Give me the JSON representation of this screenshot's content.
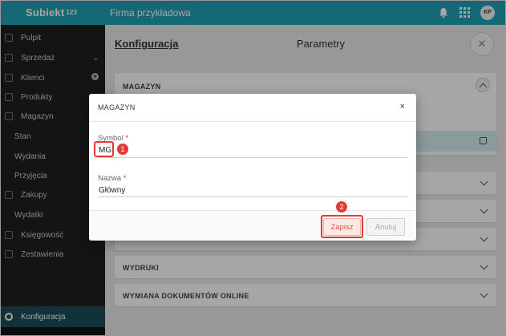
{
  "app": {
    "logo": "Subiekt",
    "logo_sup": "123",
    "company": "Firma przykładowa",
    "avatar": "KP"
  },
  "sidebar": {
    "items": [
      {
        "label": "Pulpit"
      },
      {
        "label": "Sprzedaż"
      },
      {
        "label": "Klienci"
      },
      {
        "label": "Produkty"
      },
      {
        "label": "Magazyn"
      },
      {
        "label": "Stan"
      },
      {
        "label": "Wydania"
      },
      {
        "label": "Przyjęcia"
      },
      {
        "label": "Zakupy"
      },
      {
        "label": "Wydatki"
      },
      {
        "label": "Księgowość"
      },
      {
        "label": "Zestawienia"
      }
    ],
    "active": "Konfiguracja"
  },
  "main": {
    "title": "Konfiguracja",
    "subtitle": "Parametry",
    "panels": {
      "magazyn": "MAGAZYN",
      "wydruki": "WYDRUKI",
      "wymiana": "WYMIANA DOKUMENTÓW ONLINE"
    }
  },
  "modal": {
    "title": "MAGAZYN",
    "close": "×",
    "symbol_label": "Symbol",
    "symbol_value": "MG",
    "name_label": "Nazwa",
    "name_value": "Główny",
    "required_mark": "*",
    "save": "Zapisz",
    "cancel": "Anuluj",
    "badge1": "1",
    "badge2": "2"
  },
  "colors": {
    "brand": "#21a0b5",
    "sidebar": "#1f1f1f",
    "active": "#1b4e58",
    "highlight": "#e53935"
  }
}
